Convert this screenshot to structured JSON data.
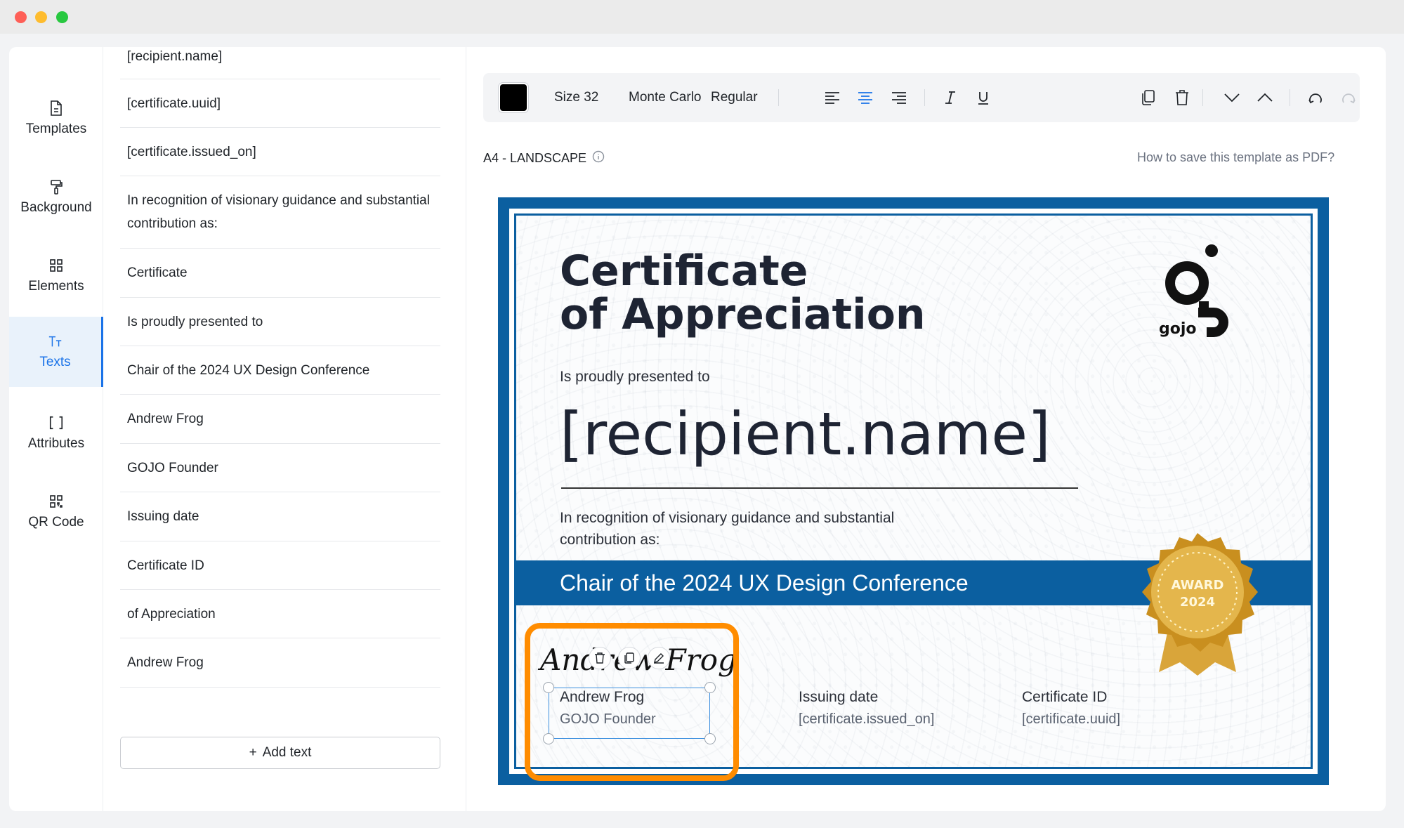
{
  "rail": [
    {
      "label": "Templates",
      "icon": "file-icon"
    },
    {
      "label": "Background",
      "icon": "paint-roller-icon"
    },
    {
      "label": "Elements",
      "icon": "grid-icon"
    },
    {
      "label": "Texts",
      "icon": "text-icon",
      "active": true
    },
    {
      "label": "Attributes",
      "icon": "brackets-icon"
    },
    {
      "label": "QR Code",
      "icon": "qr-icon"
    }
  ],
  "texts_list": {
    "items": [
      "[recipient.name]",
      "[certificate.uuid]",
      "[certificate.issued_on]",
      "In recognition of visionary guidance and substantial contribution as:",
      "Certificate",
      "Is proudly presented to",
      "Chair of the 2024 UX Design Conference",
      "Andrew Frog",
      "GOJO Founder",
      "Issuing date",
      "Certificate ID",
      "of Appreciation",
      "Andrew Frog"
    ],
    "add_button": "Add text"
  },
  "toolbar": {
    "color": "#000000",
    "size_label": "Size 32",
    "font_family": "Monte Carlo",
    "font_weight": "Regular",
    "active_align": "center"
  },
  "paper": {
    "label": "A4 - LANDSCAPE",
    "help_link": "How to save this template as PDF?"
  },
  "certificate": {
    "title_line1": "Certificate",
    "title_line2": "of Appreciation",
    "presented": "Is proudly presented to",
    "recipient": "[recipient.name]",
    "recognition": "In recognition of visionary guidance and substantial contribution as:",
    "band_text": "Chair of the 2024 UX Design Conference",
    "signature": "Andrew Frog",
    "signer_name": "Andrew Frog",
    "signer_role": "GOJO Founder",
    "issuing_label": "Issuing date",
    "issuing_value": "[certificate.issued_on]",
    "id_label": "Certificate ID",
    "id_value": "[certificate.uuid]",
    "logo_text": "gojo",
    "seal_line1": "AWARD",
    "seal_line2": "2024",
    "brand_color": "#0b5fa0",
    "highlight_color": "#ff8c00"
  }
}
